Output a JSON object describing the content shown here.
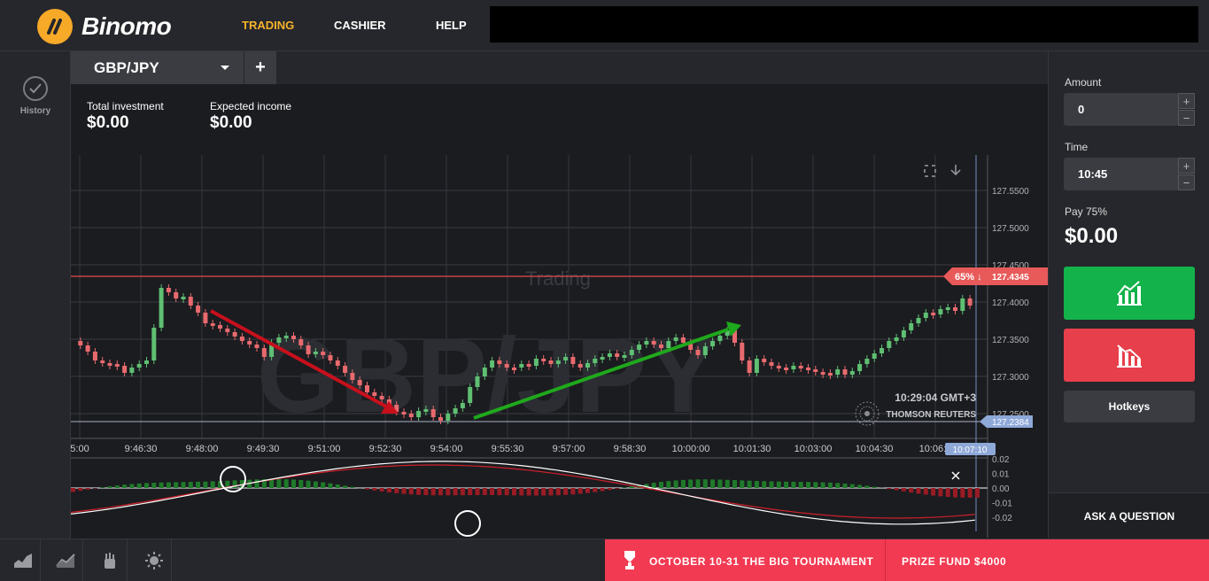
{
  "brand": {
    "name": "Binomo"
  },
  "nav": {
    "trading": "TRADING",
    "cashier": "CASHIER",
    "help": "HELP"
  },
  "sidebar": {
    "history_label": "History"
  },
  "tabs": {
    "asset": "GBP/JPY",
    "add": "+"
  },
  "stats": {
    "total_investment_label": "Total investment",
    "total_investment_value": "$0.00",
    "expected_income_label": "Expected income",
    "expected_income_value": "$0.00"
  },
  "chart": {
    "watermark": "GBP/JPY",
    "mode_label": "Trading",
    "current_price": "127.2384",
    "strike_label": "65% ↓",
    "strike_price": "127.4345",
    "clock": "10:29:04 GMT+3",
    "provider": "THOMSON REUTERS",
    "cursor_time": "10:07:10",
    "price_ticks": [
      "127.5500",
      "127.5000",
      "127.4500",
      "127.4000",
      "127.3500",
      "127.3000",
      "127.2500"
    ],
    "time_ticks": [
      "5:00",
      "9:46:30",
      "9:48:00",
      "9:49:30",
      "9:51:00",
      "9:52:30",
      "9:54:00",
      "9:55:30",
      "9:57:00",
      "9:58:30",
      "10:00:00",
      "10:01:30",
      "10:03:00",
      "10:04:30",
      "10:06:0"
    ],
    "osc_ticks": [
      "0.02",
      "0.01",
      "0.00",
      "-0.01",
      "-0.02"
    ],
    "colors": {
      "up": "#5fbf72",
      "down": "#e86a6e",
      "strike_line": "#e24c4c",
      "arrow_down": "#c8101c",
      "arrow_up": "#1fa91c"
    }
  },
  "panel": {
    "amount_label": "Amount",
    "amount_value": "0",
    "time_label": "Time",
    "time_value": "10:45",
    "pay_label": "Pay 75%",
    "pay_value": "$0.00",
    "hotkeys": "Hotkeys",
    "ask": "ASK A QUESTION",
    "plus": "+",
    "minus": "−"
  },
  "promo": {
    "tournament": "OCTOBER 10-31 THE BIG TOURNAMENT",
    "prize": "PRIZE FUND $4000"
  }
}
